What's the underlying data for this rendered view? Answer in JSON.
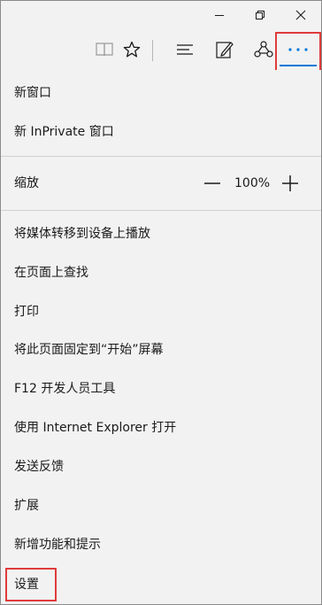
{
  "window": {
    "controls": [
      "minimize",
      "restore",
      "close"
    ]
  },
  "toolbar": {
    "icons": [
      "reading-view-icon",
      "favorite-star-icon",
      "hub-icon",
      "web-note-icon",
      "share-icon",
      "more-icon"
    ]
  },
  "menu": {
    "new_window": "新窗口",
    "new_inprivate_window": "新 InPrivate 窗口",
    "zoom_label": "缩放",
    "zoom_value": "100%",
    "cast_media": "将媒体转移到设备上播放",
    "find_on_page": "在页面上查找",
    "print": "打印",
    "pin_to_start": "将此页面固定到“开始”屏幕",
    "f12_dev_tools": "F12 开发人员工具",
    "open_with_ie": "使用 Internet Explorer 打开",
    "send_feedback": "发送反馈",
    "extensions": "扩展",
    "whats_new": "新增功能和提示",
    "settings": "设置"
  },
  "colors": {
    "accent": "#0078d7",
    "highlight": "#e03b3b",
    "background": "#f2f2f2"
  }
}
